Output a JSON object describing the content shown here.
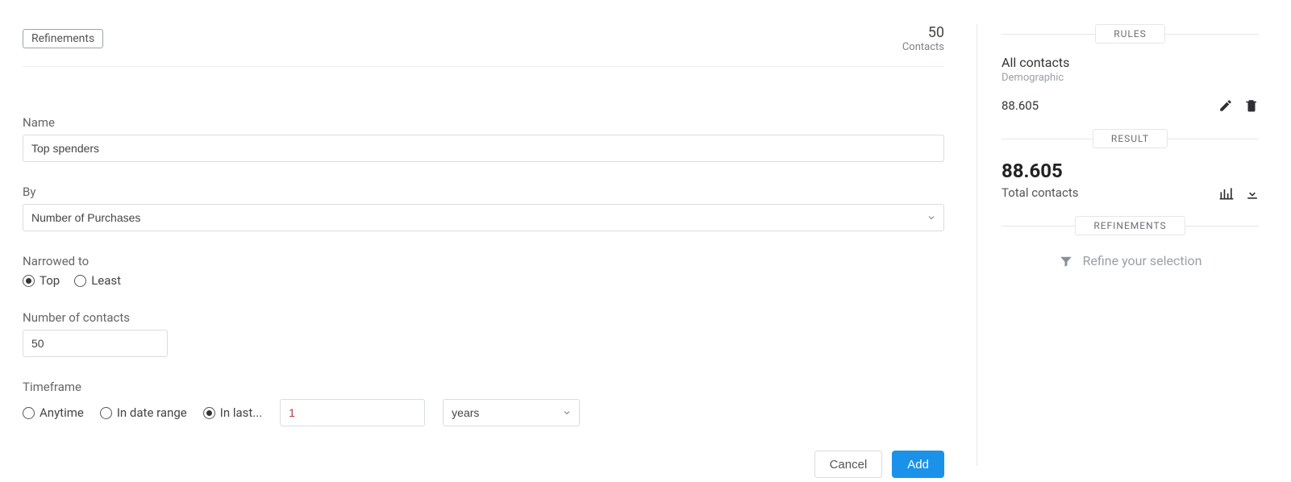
{
  "main": {
    "refinements_tag": "Refinements",
    "summary": {
      "count": "50",
      "label": "Contacts"
    },
    "form": {
      "name": {
        "label": "Name",
        "value": "Top spenders"
      },
      "by": {
        "label": "By",
        "value": "Number of Purchases"
      },
      "narrowed": {
        "label": "Narrowed to",
        "options": {
          "top": "Top",
          "least": "Least"
        },
        "selected": "top"
      },
      "num_contacts": {
        "label": "Number of contacts",
        "value": "50"
      },
      "timeframe": {
        "label": "Timeframe",
        "options": {
          "anytime": "Anytime",
          "range": "In date range",
          "inlast": "In last..."
        },
        "selected": "inlast",
        "inlast_value": "1",
        "unit": "years"
      },
      "buttons": {
        "cancel": "Cancel",
        "add": "Add"
      }
    }
  },
  "side": {
    "sections": {
      "rules": "RULES",
      "result": "RESULT",
      "refinements": "REFINEMENTS"
    },
    "rule": {
      "title": "All contacts",
      "subtitle": "Demographic",
      "count": "88.605"
    },
    "result": {
      "count": "88.605",
      "label": "Total contacts"
    },
    "refine_hint": "Refine your selection"
  }
}
